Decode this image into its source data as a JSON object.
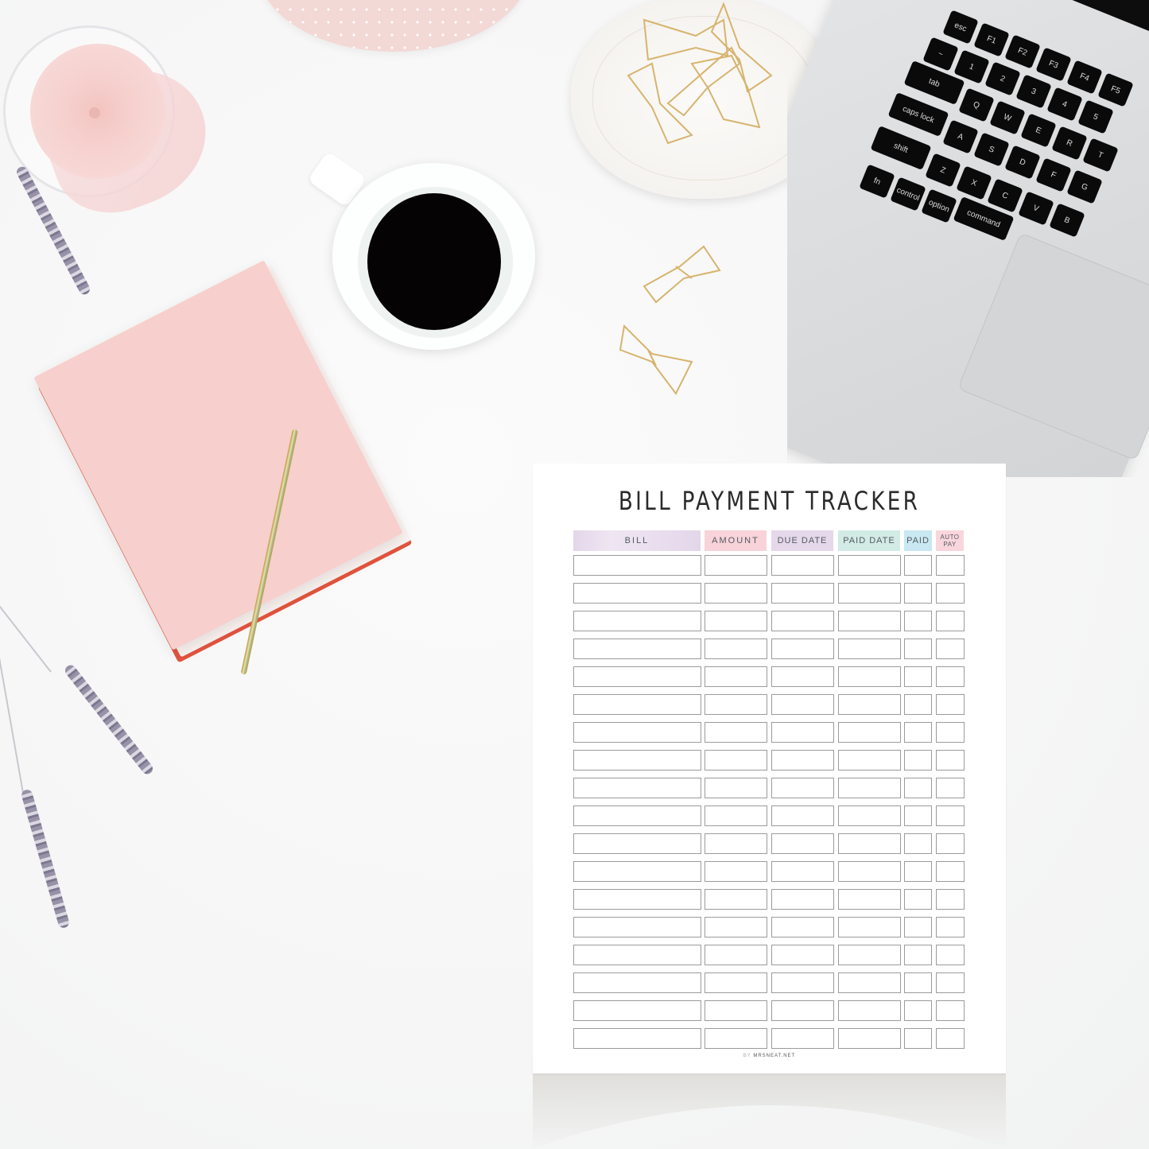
{
  "scene": {
    "description": "Flat-lay desk with printable planner sheet",
    "objects": [
      "pink dotted plate",
      "pink candle in glass",
      "lavender sprigs",
      "coffee cup",
      "saucer with gold bow paper clips",
      "gold bow paper clips",
      "pink notebook",
      "gold pen",
      "laptop"
    ]
  },
  "laptop": {
    "keys": [
      {
        "label": "esc"
      },
      {
        "label": "F1"
      },
      {
        "label": "F2"
      },
      {
        "label": "F3"
      },
      {
        "label": "F4"
      },
      {
        "label": "F5"
      },
      {
        "label": "~"
      },
      {
        "label": "1"
      },
      {
        "label": "2"
      },
      {
        "label": "3"
      },
      {
        "label": "4"
      },
      {
        "label": "5"
      },
      {
        "label": "tab"
      },
      {
        "label": "Q"
      },
      {
        "label": "W"
      },
      {
        "label": "E"
      },
      {
        "label": "R"
      },
      {
        "label": "T"
      },
      {
        "label": "caps lock"
      },
      {
        "label": "A"
      },
      {
        "label": "S"
      },
      {
        "label": "D"
      },
      {
        "label": "F"
      },
      {
        "label": "G"
      },
      {
        "label": "shift"
      },
      {
        "label": "Z"
      },
      {
        "label": "X"
      },
      {
        "label": "C"
      },
      {
        "label": "V"
      },
      {
        "label": "B"
      },
      {
        "label": "fn"
      },
      {
        "label": "control"
      },
      {
        "label": "option"
      },
      {
        "label": "command"
      }
    ]
  },
  "tracker": {
    "title": "BILL PAYMENT TRACKER",
    "columns": [
      {
        "label": "BILL",
        "color": "#e3d6ea"
      },
      {
        "label": "AMOUNT",
        "color": "#f8d3da"
      },
      {
        "label": "DUE DATE",
        "color": "#e4d8ea"
      },
      {
        "label": "PAID DATE",
        "color": "#d2ebe5"
      },
      {
        "label": "PAID",
        "color": "#c9e8f1"
      },
      {
        "label": "AUTO PAY",
        "label_line1": "AUTO",
        "label_line2": "PAY",
        "color": "#f9d6dd"
      }
    ],
    "row_count": 18,
    "footer_prefix": "BY",
    "footer_site": "MRSNEAT.NET"
  }
}
